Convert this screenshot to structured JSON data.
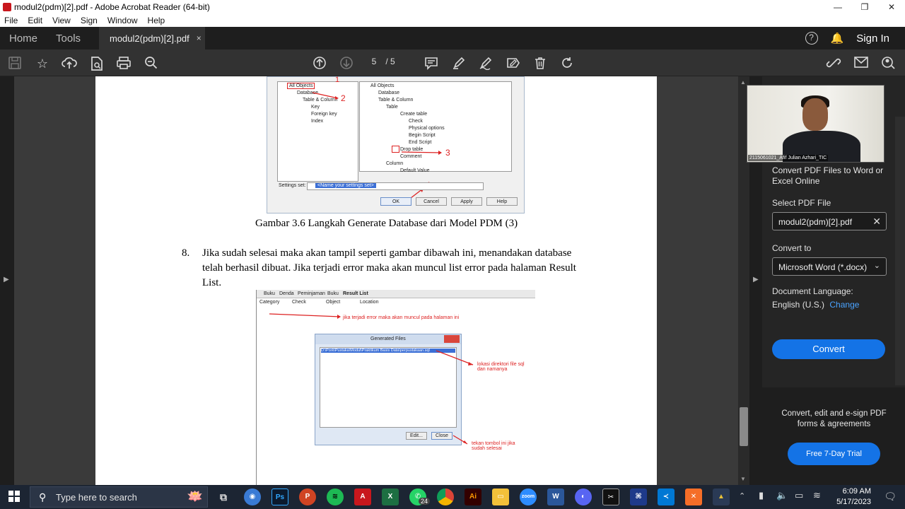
{
  "window": {
    "title": "modul2(pdm)[2].pdf - Adobe Acrobat Reader (64-bit)",
    "controls": [
      "—",
      "❐",
      "✕"
    ]
  },
  "menu": [
    "File",
    "Edit",
    "View",
    "Sign",
    "Window",
    "Help"
  ],
  "tabs": {
    "home": "Home",
    "tools": "Tools",
    "document": "modul2(pdm)[2].pdf",
    "close": "×",
    "sign_in": "Sign In"
  },
  "toolbar": {
    "page_current": "5",
    "page_total": "/ 5"
  },
  "document": {
    "fig1": {
      "tree_left": [
        "All Objects",
        "Database",
        "Table & Column",
        "Key",
        "Foreign key",
        "Index"
      ],
      "tree_right": [
        "All Objects",
        "Database",
        "Table & Column",
        "Table",
        "Create table",
        "Check",
        "Physical options",
        "Begin Script",
        "End Script",
        "Drop table",
        "Comment",
        "Column",
        "Default Value"
      ],
      "settings_label": "Settings set:",
      "settings_value": "<Name your settings set>",
      "buttons": [
        "OK",
        "Cancel",
        "Apply",
        "Help"
      ],
      "markers": [
        "1",
        "2",
        "3",
        "4"
      ]
    },
    "caption": "Gambar 3.6 Langkah Generate Database dari Model PDM (3)",
    "item_number": "8.",
    "item_text": "Jika sudah selesai maka akan tampil seperti gambar dibawah ini, menandakan database telah berhasil dibuat. Jika terjadi error maka akan muncul list error pada halaman Result List.",
    "fig2": {
      "tabs": [
        "Buku",
        "Denda",
        "Peminjaman",
        "Buku",
        "Result List"
      ],
      "columns": [
        "Category",
        "Check",
        "Object",
        "Location"
      ],
      "note_error": "jika terjadi error maka akan muncul pada halaman ini",
      "dialog_title": "Generated Files",
      "file_path": "D:\\Pork\\Pustaka\\Modul\\Praktikum Basis Data\\perpustakaan.sql",
      "note_path": "lokasi direktori file sql dan namanya",
      "btn_edit": "Edit...",
      "btn_close": "Close",
      "note_close": "tekan tombol ini jika sudah selesai"
    }
  },
  "right_panel": {
    "title": "Convert PDF Files to Word or Excel Online",
    "select_label": "Select PDF File",
    "file_name": "modul2(pdm)[2].pdf",
    "convert_to_label": "Convert to",
    "convert_to_value": "Microsoft Word (*.docx)",
    "doc_language_label": "Document Language:",
    "doc_language_value": "English (U.S.)",
    "change_link": "Change",
    "convert_button": "Convert",
    "promo_text": "Convert, edit and e-sign PDF forms & agreements",
    "trial_button": "Free 7-Day Trial"
  },
  "webcam": {
    "name": "2115061021_Afif Julian Azhari_TIC"
  },
  "taskbar": {
    "search_placeholder": "Type here to search",
    "whatsapp_badge": "24",
    "time": "6:09 AM",
    "date": "5/17/2023"
  },
  "colors": {
    "accent": "#1473e6",
    "link": "#4aa3ff",
    "annotation_red": "#d22222"
  }
}
